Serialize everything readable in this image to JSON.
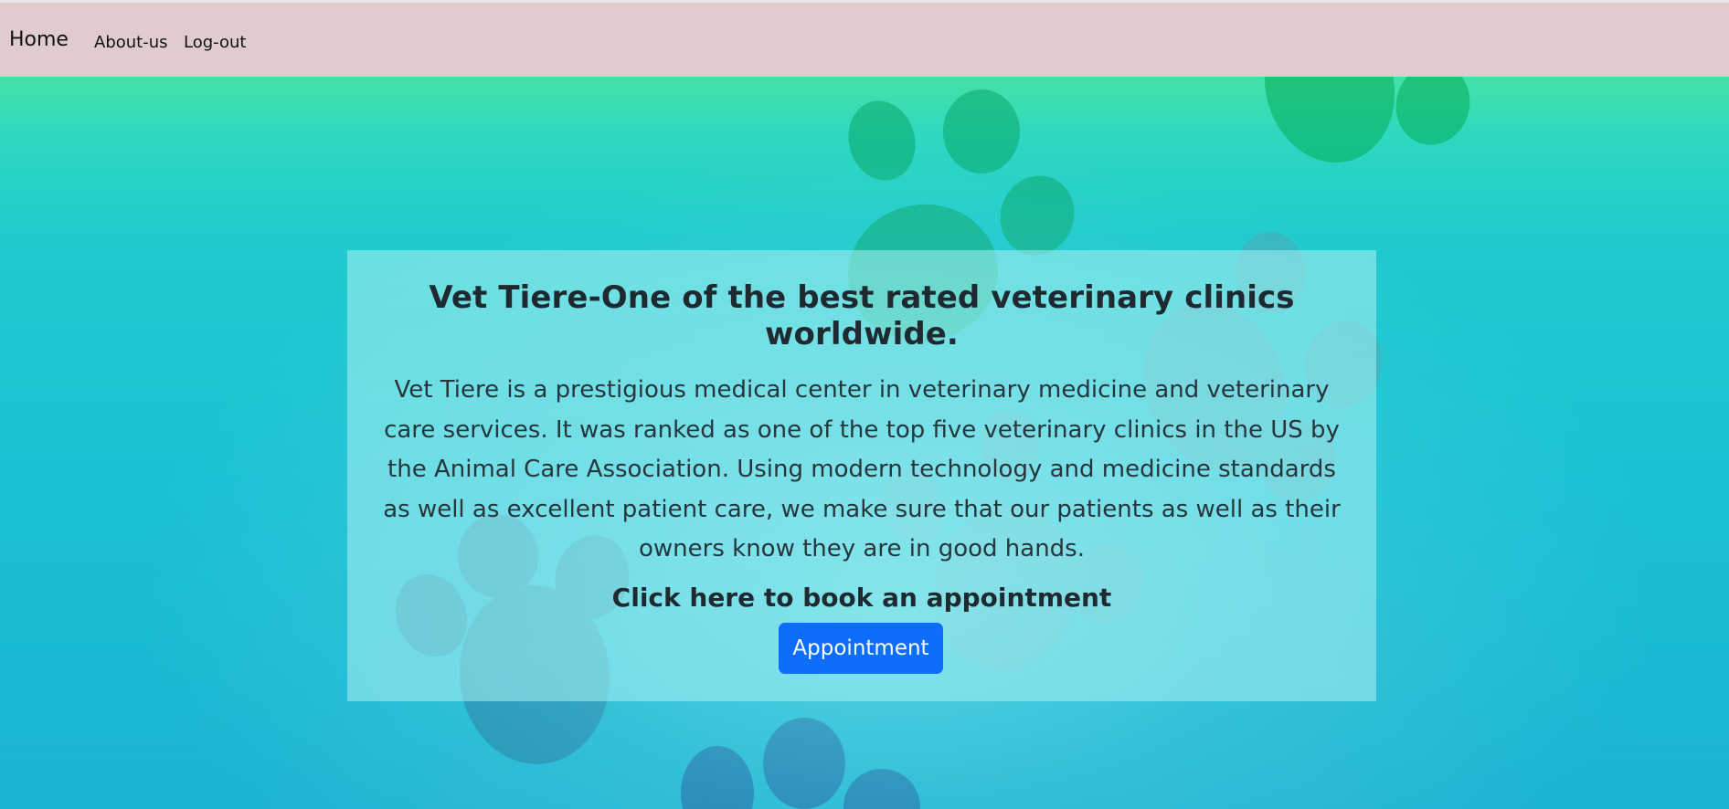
{
  "nav": {
    "brand": "Home",
    "links": [
      "About-us",
      "Log-out"
    ]
  },
  "hero": {
    "title": "Vet Tiere-One of the best rated veterinary clinics worldwide.",
    "description": "Vet Tiere is a prestigious medical center in veterinary medicine and veterinary care services. It was ranked as one of the top five veterinary clinics in the US by the Animal Care Association. Using modern technology and medicine standards as well as excellent patient care, we make sure that our patients as well as their owners know they are in good hands.",
    "cta_text": "Click here to book an appointment",
    "button_label": "Appointment"
  },
  "colors": {
    "navbar_bg": "#e0cccd",
    "button_bg": "#0d6efd",
    "background_top": "#45e1a6",
    "background_bottom": "#1cb3d2"
  },
  "background": {
    "decoration": "paw-prints"
  }
}
